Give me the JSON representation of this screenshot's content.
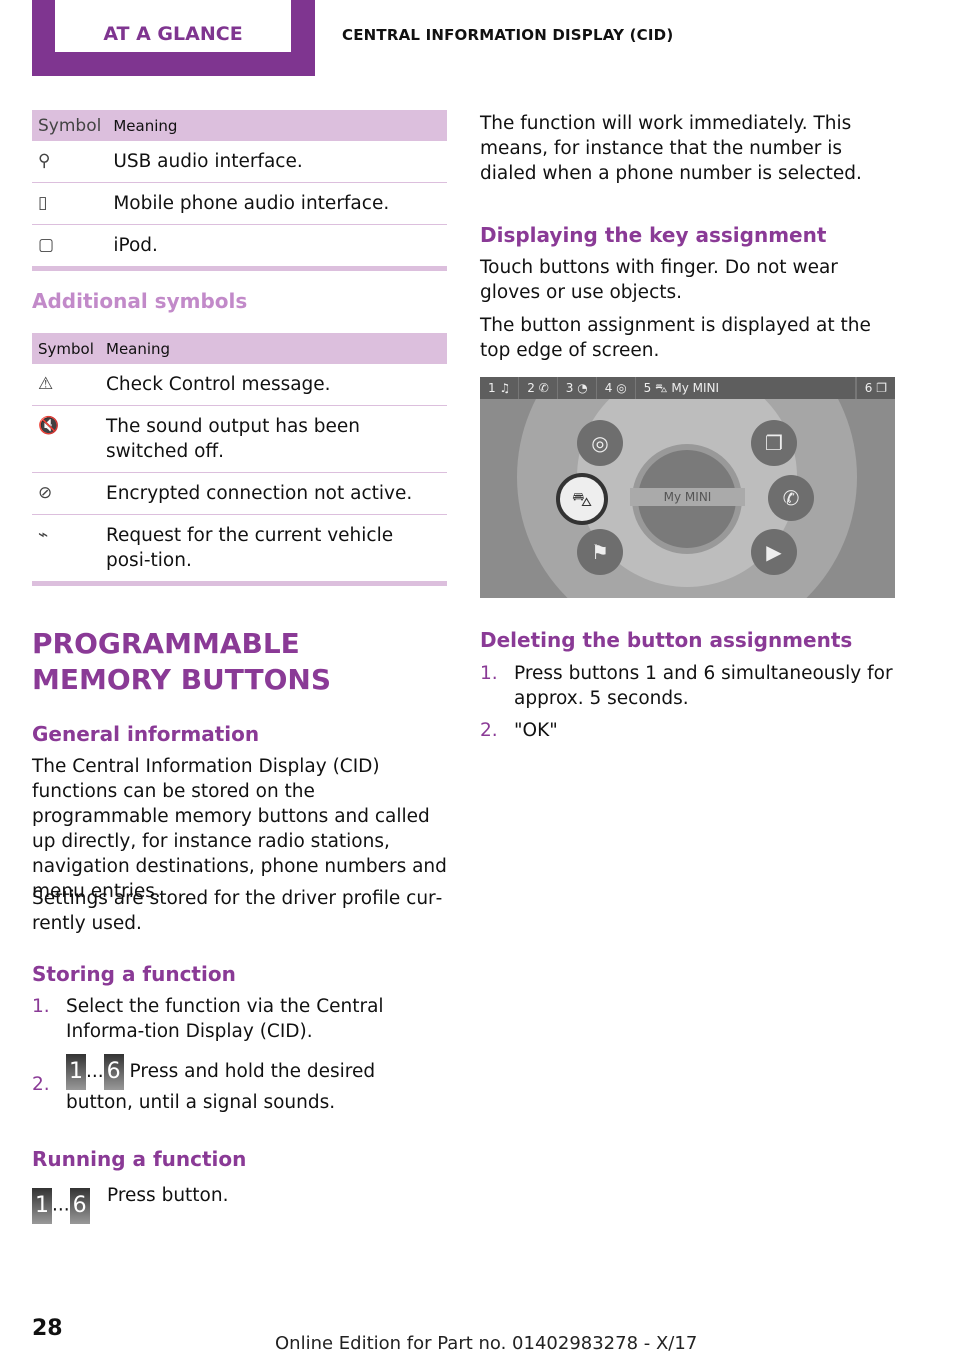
{
  "header": {
    "tab": "AT A GLANCE",
    "section": "CENTRAL INFORMATION DISPLAY (CID)"
  },
  "table1": {
    "headers": [
      "Symbol",
      "Meaning"
    ],
    "rows": [
      {
        "icon": "usb-icon",
        "glyph": "⚲",
        "meaning": "USB audio interface."
      },
      {
        "icon": "mobile-phone-icon",
        "glyph": "▯",
        "meaning": "Mobile phone audio interface."
      },
      {
        "icon": "ipod-icon",
        "glyph": "▢",
        "meaning": "iPod."
      }
    ]
  },
  "additional": {
    "title": "Additional symbols",
    "headers": [
      "Symbol",
      "Meaning"
    ],
    "rows": [
      {
        "icon": "warning-triangle-icon",
        "glyph": "⚠",
        "meaning": "Check Control message."
      },
      {
        "icon": "speaker-muted-icon",
        "glyph": "🔇",
        "meaning": "The sound output has been switched off."
      },
      {
        "icon": "encryption-off-icon",
        "glyph": "⊘",
        "meaning": "Encrypted connection not active."
      },
      {
        "icon": "vehicle-position-request-icon",
        "glyph": "⌁",
        "meaning": "Request for the current vehicle posi‐tion."
      }
    ]
  },
  "pmb": {
    "title": "PROGRAMMABLE MEMORY BUTTONS",
    "general_title": "General information",
    "general_p1": "The Central Information Display (CID) functions can be stored on the programmable memory buttons and called up directly, for instance radio stations, navigation destinations, phone numbers and menu entries.",
    "general_p2": "Settings are stored for the driver profile cur‐rently used.",
    "storing_title": "Storing a function",
    "storing_steps": [
      "Select the function via the Central Informa‐tion Display (CID).",
      "Press and hold the desired button, until a signal sounds."
    ],
    "running_title": "Running a function",
    "running_text": "Press button.",
    "key_first": "1",
    "key_last": "6",
    "ellipsis": "..."
  },
  "right": {
    "p1": "The function will work immediately. This means, for instance that the number is dialed when a phone number is selected.",
    "display_title": "Displaying the key assignment",
    "display_p1": "Touch buttons with finger. Do not wear gloves or use objects.",
    "display_p2": "The button assignment is displayed at the top edge of screen.",
    "screen": {
      "buttons": [
        {
          "num": "1",
          "icon": "music-note-icon",
          "glyph": "♫"
        },
        {
          "num": "2",
          "icon": "phone-icon",
          "glyph": "✆"
        },
        {
          "num": "3",
          "icon": "navigation-icon",
          "glyph": "◔"
        },
        {
          "num": "4",
          "icon": "globe-icon",
          "glyph": "◎"
        },
        {
          "num": "5",
          "icon": "car-icon",
          "glyph": "⛍",
          "label": "My MINI"
        },
        {
          "num": "6",
          "icon": "menu-window-icon",
          "glyph": "❐"
        }
      ],
      "center_label": "My MINI"
    },
    "delete_title": "Deleting the button assignments",
    "delete_steps": [
      "Press buttons 1 and 6 simultaneously for approx. 5 seconds.",
      "\"OK\""
    ]
  },
  "footer": {
    "page": "28",
    "edition": "Online Edition for Part no. 01402983278 - X/17"
  },
  "colors": {
    "accent": "#7f3590",
    "table_header": "#dcbfdd"
  }
}
